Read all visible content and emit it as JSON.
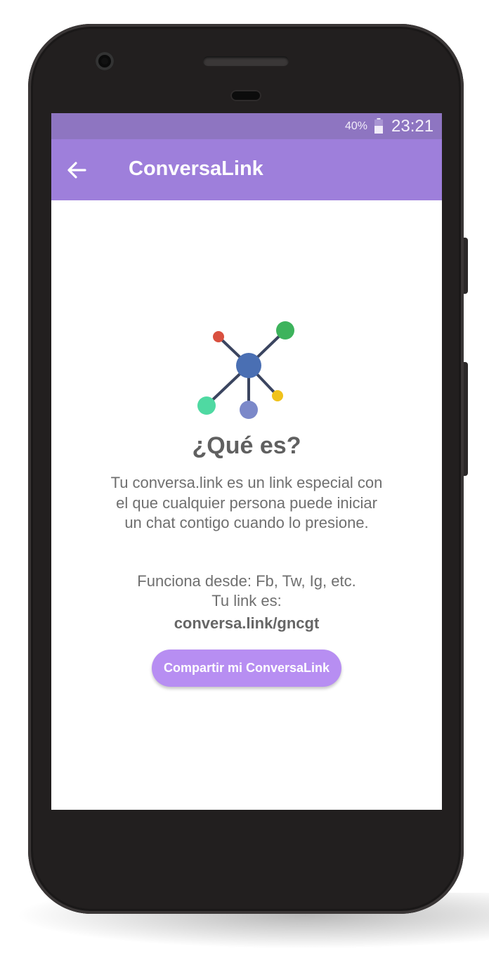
{
  "status_bar": {
    "battery_percent": "40%",
    "battery_icon": "battery-icon",
    "time": "23:21"
  },
  "app_bar": {
    "back_icon": "arrow-left-icon",
    "title": "ConversaLink"
  },
  "content": {
    "hero_icon": "network-nodes-icon",
    "headline": "¿Qué es?",
    "description": "Tu conversa.link es un link especial con el que cualquier persona puede iniciar un chat contigo cuando lo presione.",
    "works_on": "Funciona desde: Fb, Tw, Ig, etc.",
    "link_prefix": "Tu link es:",
    "link_value": "conversa.link/gncgt",
    "share_button": "Compartir mi ConversaLink"
  },
  "colors": {
    "status_bar": "#8e75c1",
    "app_bar": "#9e7fdb",
    "button": "#b78ef2",
    "node_center": "#4a6fb3",
    "node_green": "#3db35c",
    "node_red": "#d9503f",
    "node_yellow": "#f0c21b",
    "node_teal": "#4fd9a2",
    "node_lavender": "#7b88c9"
  }
}
